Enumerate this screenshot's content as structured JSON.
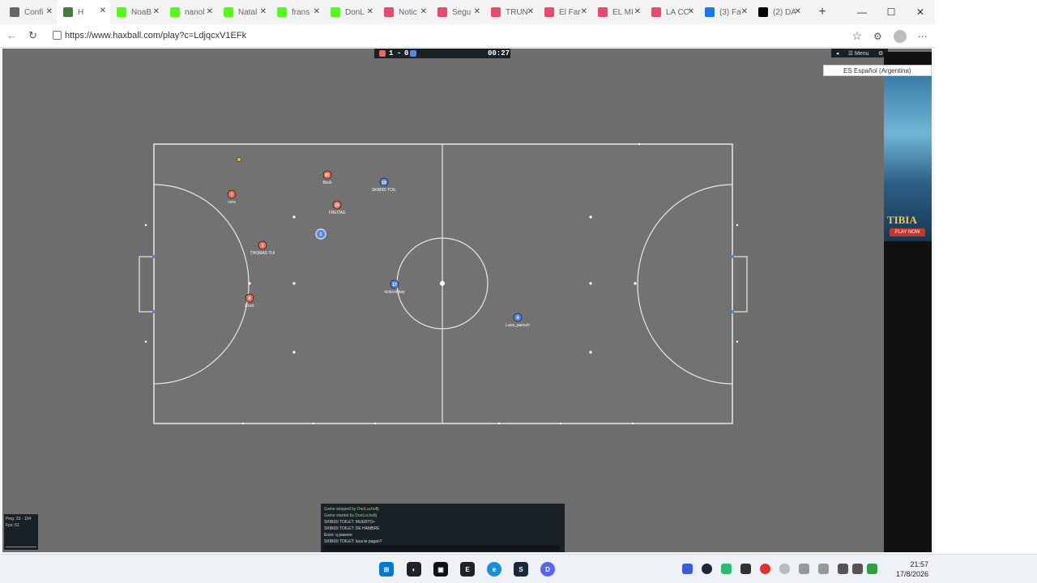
{
  "browser": {
    "tabs": [
      {
        "title": "Confi",
        "icon": "gear-icon",
        "color": "#666666"
      },
      {
        "title": "H",
        "icon": "haxball-icon",
        "color": "#4a7a3a",
        "active": true
      },
      {
        "title": "NoaB",
        "icon": "kick-icon",
        "color": "#53fc18"
      },
      {
        "title": "nanol",
        "icon": "kick-icon",
        "color": "#53fc18"
      },
      {
        "title": "Natal",
        "icon": "kick-icon",
        "color": "#53fc18"
      },
      {
        "title": "frans",
        "icon": "kick-icon",
        "color": "#53fc18"
      },
      {
        "title": "DonL",
        "icon": "kick-icon",
        "color": "#53fc18"
      },
      {
        "title": "Notic",
        "icon": "youtube-icon",
        "color": "#e74c6f"
      },
      {
        "title": "Segu",
        "icon": "youtube-icon",
        "color": "#e74c6f"
      },
      {
        "title": "TRUN",
        "icon": "youtube-icon",
        "color": "#e74c6f"
      },
      {
        "title": "El Far",
        "icon": "youtube-icon",
        "color": "#e74c6f"
      },
      {
        "title": "EL MI",
        "icon": "youtube-icon",
        "color": "#e74c6f"
      },
      {
        "title": "LA CC",
        "icon": "youtube-icon",
        "color": "#e74c6f"
      },
      {
        "title": "(3) Fa",
        "icon": "facebook-icon",
        "color": "#1877f2"
      },
      {
        "title": "(2) DA",
        "icon": "x-icon",
        "color": "#000000"
      }
    ],
    "url": "https://www.haxball.com/play?c=LdjqcxV1EFk"
  },
  "game": {
    "score_red": "1",
    "score_sep": "-",
    "score_blue": "0",
    "timer": "00:27",
    "menu_label": "Menu",
    "language": "ES Español (Argentina)",
    "ad": {
      "title": "TIBIA",
      "button": "PLAY NOW"
    },
    "players": [
      {
        "team": "red",
        "number": "81",
        "name": "Bock"
      },
      {
        "team": "red",
        "number": "7",
        "name": "cers"
      },
      {
        "team": "red",
        "number": "26",
        "name": "FREITAS"
      },
      {
        "team": "red",
        "number": "3",
        "name": "THOMAS TUI"
      },
      {
        "team": "red",
        "number": "8",
        "name": "Enzo"
      },
      {
        "team": "blue",
        "number": "10",
        "name": "SKIBIDI TOIL"
      },
      {
        "team": "blue",
        "number": "2",
        "name": ""
      },
      {
        "team": "blue",
        "number": "17",
        "name": "richicrinbay"
      },
      {
        "team": "blue",
        "number": "4",
        "name": "Luca_parisch"
      }
    ],
    "stats": {
      "ping": "Ping: 33 - 104",
      "fps": "Fps: 61"
    },
    "chat": [
      {
        "text": "Game stopped by DonLucho8j",
        "system": true
      },
      {
        "text": "Game started by DonLucho8j",
        "system": true
      },
      {
        "text": "SKIBIDI TOILET: MUERTO+",
        "system": false
      },
      {
        "text": "SKIBIDI TOILET: DE HAMBRE",
        "system": false
      },
      {
        "text": "Enzo: q paseee",
        "system": false
      },
      {
        "text": "SKIBIDI TOILET: luca te pagan?",
        "system": false
      }
    ]
  },
  "taskbar": {
    "time": "21:57",
    "date": "17/8/2026"
  },
  "colors": {
    "red_team": "#e56e56",
    "blue_team": "#5689e5",
    "pitch": "#6e6e6e",
    "ball": "#f2c232"
  }
}
